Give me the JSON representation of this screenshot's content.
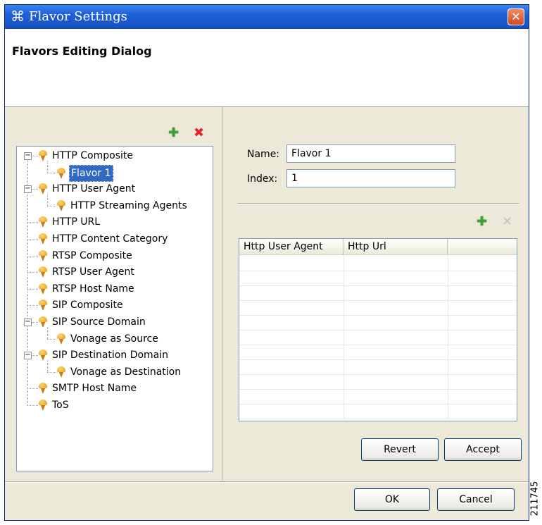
{
  "window": {
    "title": "Flavor Settings",
    "close_glyph": "✕",
    "app_icon": "⌘"
  },
  "header": {
    "heading": "Flavors Editing Dialog"
  },
  "tree_toolbar": {
    "add_icon": "add-icon",
    "delete_icon": "delete-icon",
    "add_glyph": "✚",
    "delete_glyph": "✖"
  },
  "tree": {
    "items": [
      {
        "label": "HTTP Composite",
        "level": 0,
        "expanded": true
      },
      {
        "label": "Flavor 1",
        "level": 1,
        "selected": true
      },
      {
        "label": "HTTP User Agent",
        "level": 0,
        "expanded": true
      },
      {
        "label": "HTTP Streaming Agents",
        "level": 1
      },
      {
        "label": "HTTP URL",
        "level": 0
      },
      {
        "label": "HTTP Content Category",
        "level": 0
      },
      {
        "label": "RTSP Composite",
        "level": 0
      },
      {
        "label": "RTSP User Agent",
        "level": 0
      },
      {
        "label": "RTSP Host Name",
        "level": 0
      },
      {
        "label": "SIP Composite",
        "level": 0
      },
      {
        "label": "SIP Source Domain",
        "level": 0,
        "expanded": true
      },
      {
        "label": "Vonage as Source",
        "level": 1
      },
      {
        "label": "SIP Destination Domain",
        "level": 0,
        "expanded": true
      },
      {
        "label": "Vonage as Destination",
        "level": 1
      },
      {
        "label": "SMTP Host Name",
        "level": 0
      },
      {
        "label": "ToS",
        "level": 0
      }
    ]
  },
  "details": {
    "name_label": "Name:",
    "name_value": "Flavor 1",
    "index_label": "Index:",
    "index_value": "1"
  },
  "grid_toolbar": {
    "add_glyph": "✚",
    "delete_glyph": "✕",
    "delete_enabled": false
  },
  "grid": {
    "columns": [
      "Http User Agent",
      "Http Url",
      ""
    ],
    "rows": []
  },
  "buttons": {
    "revert": "Revert",
    "accept": "Accept",
    "ok": "OK",
    "cancel": "Cancel"
  },
  "figure_id": "211745",
  "colors": {
    "titlebar": "#1f5fd9",
    "selection": "#316ac5",
    "dialog_bg": "#ece9d8",
    "add": "#3ea337",
    "delete": "#e0242a"
  }
}
